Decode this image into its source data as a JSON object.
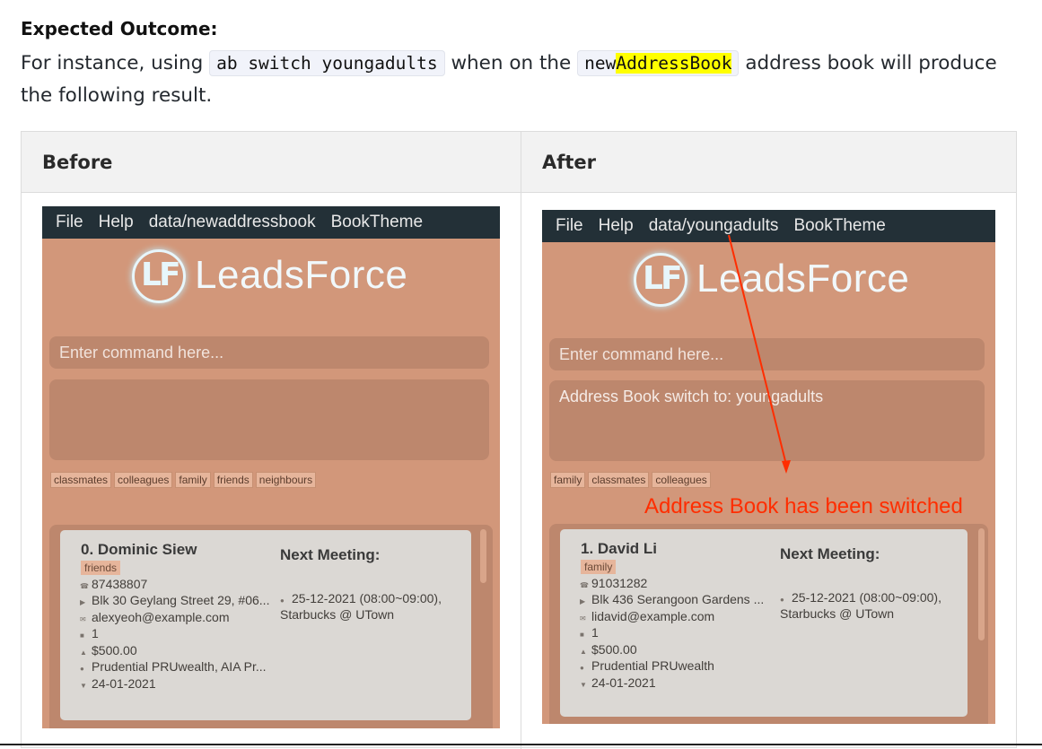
{
  "heading": "Expected Outcome:",
  "intro": {
    "part1": "For instance, using ",
    "code1": "ab switch youngadults",
    "part2": " when on the ",
    "code2_prefix": "new",
    "code2_highlight": "AddressBook",
    "part3": " address book will produce the following result."
  },
  "table": {
    "before_header": "Before",
    "after_header": "After"
  },
  "before": {
    "menu": [
      "File",
      "Help",
      "data/newaddressbook",
      "BookTheme"
    ],
    "logo_text": "LeadsForce",
    "logo_mark": "LF",
    "command_placeholder": "Enter command here...",
    "result_text": "",
    "tags": [
      "classmates",
      "colleagues",
      "family",
      "friends",
      "neighbours"
    ],
    "card": {
      "name": "0.  Dominic Siew",
      "tag": "friends",
      "phone": "87438807",
      "address": "Blk 30 Geylang Street 29, #06...",
      "email": "alexyeoh@example.com",
      "risk": "1",
      "income": "$500.00",
      "policy": "Prudential PRUwealth, AIA Pr...",
      "date": "24-01-2021",
      "next_meeting_label": "Next Meeting:",
      "meeting_line1": "25-12-2021 (08:00~09:00),",
      "meeting_line2": "Starbucks @ UTown"
    }
  },
  "after": {
    "menu": [
      "File",
      "Help",
      "data/youngadults",
      "BookTheme"
    ],
    "logo_text": "LeadsForce",
    "logo_mark": "LF",
    "command_placeholder": "Enter command here...",
    "result_text": "Address Book switch to: youngadults",
    "tags": [
      "family",
      "classmates",
      "colleagues"
    ],
    "card": {
      "name": "1.  David Li",
      "tag": "family",
      "phone": "91031282",
      "address": "Blk 436 Serangoon Gardens ...",
      "email": "lidavid@example.com",
      "risk": "1",
      "income": "$500.00",
      "policy": "Prudential PRUwealth",
      "date": "24-01-2021",
      "next_meeting_label": "Next Meeting:",
      "meeting_line1": "25-12-2021 (08:00~09:00),",
      "meeting_line2": "Starbucks @ UTown"
    },
    "annotation": "Address Book has been switched"
  },
  "colors": {
    "app_bg": "#d2977a",
    "menubar": "#233037",
    "annotation": "#ff2d00",
    "highlight": "#ffff00"
  }
}
